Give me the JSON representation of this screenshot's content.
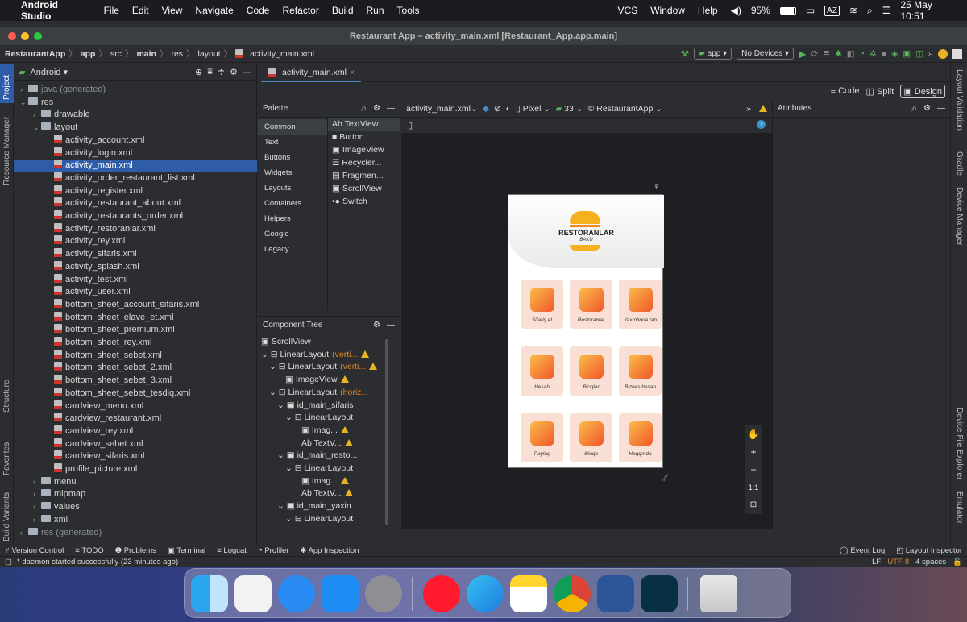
{
  "menubar": {
    "app": "Android Studio",
    "items": [
      "File",
      "Edit",
      "View",
      "Navigate",
      "Code",
      "Refactor",
      "Build",
      "Run",
      "Tools"
    ],
    "right_items": [
      "VCS",
      "Window",
      "Help"
    ],
    "battery": "95%",
    "kb": "AZ",
    "datetime": "25 May 10:51"
  },
  "window": {
    "title": "Restaurant App – activity_main.xml [Restaurant_App.app.main]"
  },
  "breadcrumb": [
    "RestaurantApp",
    "app",
    "src",
    "main",
    "res",
    "layout",
    "activity_main.xml"
  ],
  "run_config": {
    "module": "app",
    "device": "No Devices"
  },
  "project_panel": {
    "view": "Android",
    "tree": [
      {
        "label": "java (generated)",
        "indent": 1,
        "kind": "folder-gen",
        "arrow": "›"
      },
      {
        "label": "res",
        "indent": 1,
        "kind": "folder",
        "arrow": "⌄"
      },
      {
        "label": "drawable",
        "indent": 2,
        "kind": "folder",
        "arrow": "›"
      },
      {
        "label": "layout",
        "indent": 2,
        "kind": "folder",
        "arrow": "⌄"
      },
      {
        "label": "activity_account.xml",
        "indent": 3,
        "kind": "file"
      },
      {
        "label": "activity_login.xml",
        "indent": 3,
        "kind": "file"
      },
      {
        "label": "activity_main.xml",
        "indent": 3,
        "kind": "file",
        "selected": true
      },
      {
        "label": "activity_order_restaurant_list.xml",
        "indent": 3,
        "kind": "file"
      },
      {
        "label": "activity_register.xml",
        "indent": 3,
        "kind": "file"
      },
      {
        "label": "activity_restaurant_about.xml",
        "indent": 3,
        "kind": "file"
      },
      {
        "label": "activity_restaurants_order.xml",
        "indent": 3,
        "kind": "file"
      },
      {
        "label": "activity_restoranlar.xml",
        "indent": 3,
        "kind": "file"
      },
      {
        "label": "activity_rey.xml",
        "indent": 3,
        "kind": "file"
      },
      {
        "label": "activity_sifaris.xml",
        "indent": 3,
        "kind": "file"
      },
      {
        "label": "activity_splash.xml",
        "indent": 3,
        "kind": "file"
      },
      {
        "label": "activity_test.xml",
        "indent": 3,
        "kind": "file"
      },
      {
        "label": "activity_user.xml",
        "indent": 3,
        "kind": "file"
      },
      {
        "label": "bottom_sheet_account_sifaris.xml",
        "indent": 3,
        "kind": "file"
      },
      {
        "label": "bottom_sheet_elave_et.xml",
        "indent": 3,
        "kind": "file"
      },
      {
        "label": "bottom_sheet_premium.xml",
        "indent": 3,
        "kind": "file"
      },
      {
        "label": "bottom_sheet_rey.xml",
        "indent": 3,
        "kind": "file"
      },
      {
        "label": "bottom_sheet_sebet.xml",
        "indent": 3,
        "kind": "file"
      },
      {
        "label": "bottom_sheet_sebet_2.xml",
        "indent": 3,
        "kind": "file"
      },
      {
        "label": "bottom_sheet_sebet_3.xml",
        "indent": 3,
        "kind": "file"
      },
      {
        "label": "bottom_sheet_sebet_tesdiq.xml",
        "indent": 3,
        "kind": "file"
      },
      {
        "label": "cardview_menu.xml",
        "indent": 3,
        "kind": "file"
      },
      {
        "label": "cardview_restaurant.xml",
        "indent": 3,
        "kind": "file"
      },
      {
        "label": "cardview_rey.xml",
        "indent": 3,
        "kind": "file"
      },
      {
        "label": "cardview_sebet.xml",
        "indent": 3,
        "kind": "file"
      },
      {
        "label": "cardview_sifaris.xml",
        "indent": 3,
        "kind": "file"
      },
      {
        "label": "profile_picture.xml",
        "indent": 3,
        "kind": "file"
      },
      {
        "label": "menu",
        "indent": 2,
        "kind": "folder",
        "arrow": "›"
      },
      {
        "label": "mipmap",
        "indent": 2,
        "kind": "folder",
        "arrow": "›"
      },
      {
        "label": "values",
        "indent": 2,
        "kind": "folder",
        "arrow": "›"
      },
      {
        "label": "xml",
        "indent": 2,
        "kind": "folder",
        "arrow": "›"
      },
      {
        "label": "res (generated)",
        "indent": 1,
        "kind": "folder-gen",
        "arrow": "›"
      }
    ]
  },
  "left_stripe": [
    "Project",
    "Resource Manager",
    "Structure",
    "Favorites",
    "Build Variants"
  ],
  "right_stripe": [
    "Layout Validation",
    "Gradle",
    "Device Manager",
    "Device File Explorer",
    "Emulator"
  ],
  "editor": {
    "tab": "activity_main.xml",
    "modes": [
      "Code",
      "Split",
      "Design"
    ],
    "active_mode": "Design"
  },
  "palette": {
    "title": "Palette",
    "categories": [
      "Common",
      "Text",
      "Buttons",
      "Widgets",
      "Layouts",
      "Containers",
      "Helpers",
      "Google",
      "Legacy"
    ],
    "items": [
      "TextView",
      "Button",
      "ImageView",
      "Recycler...",
      "Fragmen...",
      "ScrollView",
      "Switch"
    ],
    "item_prefix": "Ab"
  },
  "component_tree": {
    "title": "Component Tree",
    "nodes": [
      {
        "label": "ScrollView",
        "indent": 0,
        "arrow": ""
      },
      {
        "label": "LinearLayout",
        "hint": "(verti...",
        "indent": 0,
        "arrow": "⌄",
        "warn": true
      },
      {
        "label": "LinearLayout",
        "hint": "(verti...",
        "indent": 1,
        "arrow": "⌄",
        "warn": true
      },
      {
        "label": "ImageView",
        "indent": 3,
        "arrow": "",
        "warn": true
      },
      {
        "label": "LinearLayout",
        "hint": "(horiz...",
        "indent": 1,
        "arrow": "⌄"
      },
      {
        "label": "id_main_sifaris",
        "indent": 2,
        "arrow": "⌄"
      },
      {
        "label": "LinearLayout",
        "indent": 3,
        "arrow": "⌄"
      },
      {
        "label": "Imag...",
        "indent": 5,
        "arrow": "",
        "warn": true
      },
      {
        "label": "TextV...",
        "prefix": "Ab",
        "indent": 5,
        "arrow": "",
        "warn": true
      },
      {
        "label": "id_main_resto...",
        "indent": 2,
        "arrow": "⌄"
      },
      {
        "label": "LinearLayout",
        "indent": 3,
        "arrow": "⌄"
      },
      {
        "label": "Imag...",
        "indent": 5,
        "arrow": "",
        "warn": true
      },
      {
        "label": "TextV...",
        "prefix": "Ab",
        "indent": 5,
        "arrow": "",
        "warn": true
      },
      {
        "label": "id_main_yaxin...",
        "indent": 2,
        "arrow": "⌄"
      },
      {
        "label": "LinearLayout",
        "indent": 3,
        "arrow": "⌄"
      }
    ]
  },
  "design_toolbar": {
    "file": "activity_main.xml",
    "device": "Pixel",
    "api": "33",
    "theme": "RestaurantApp",
    "overflow": "»"
  },
  "attributes": {
    "title": "Attributes"
  },
  "app_preview": {
    "logo_title": "RESTORANLAR",
    "logo_subtitle": "BAKU",
    "cards": [
      "Sifariş et",
      "Restoranlar",
      "Yaxınlıqda tap",
      "Hesab",
      "Bloqlar",
      "Biznes hesab",
      "Paylaş",
      "Əlaqə",
      "Haqqında"
    ]
  },
  "zoom": [
    "+",
    "−",
    "1:1"
  ],
  "bottom_tools": [
    "Version Control",
    "TODO",
    "Problems",
    "Terminal",
    "Logcat",
    "Profiler",
    "App Inspection"
  ],
  "bottom_right": [
    "Event Log",
    "Layout Inspector"
  ],
  "status": {
    "message": "* daemon started successfully (23 minutes ago)",
    "lf": "LF",
    "encoding": "UTF-8",
    "indent": "4 spaces"
  },
  "dock_apps": [
    "Finder",
    "Launchpad",
    "Safari",
    "App Store",
    "System Preferences",
    "Opera",
    "Edge",
    "Notes",
    "Chrome",
    "Word",
    "Android Studio",
    "Trash"
  ],
  "colors": {
    "accent": "#2e5ca8",
    "orange": "#f07a2a",
    "card_bg": "#fae0d4",
    "warn": "#e6b422"
  }
}
